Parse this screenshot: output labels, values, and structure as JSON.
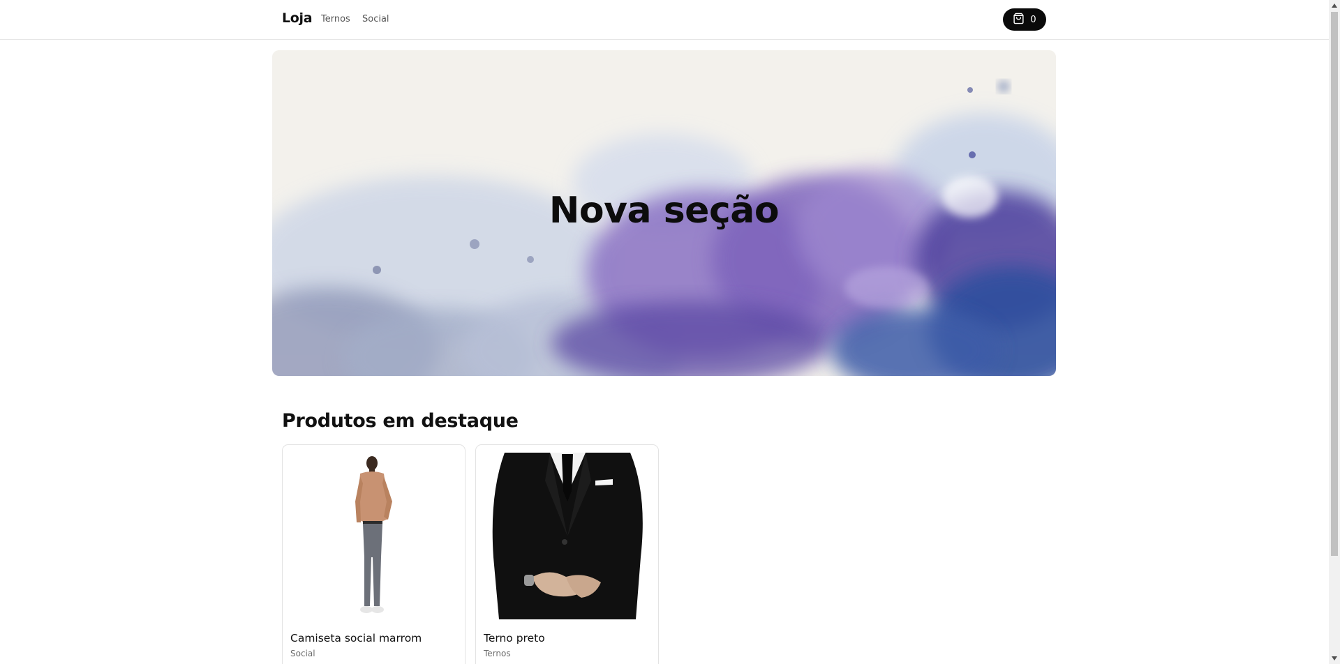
{
  "header": {
    "logo": "Loja",
    "nav": [
      {
        "label": "Ternos"
      },
      {
        "label": "Social"
      }
    ],
    "cart": {
      "icon": "shopping-bag-icon",
      "count": "0"
    }
  },
  "hero": {
    "title": "Nova seção",
    "background": "watercolor-purple-blue"
  },
  "featured": {
    "title": "Produtos em destaque",
    "products": [
      {
        "name": "Camiseta social marrom",
        "category": "Social",
        "image": "man-in-brown-shirt"
      },
      {
        "name": "Terno preto",
        "category": "Ternos",
        "image": "black-suit"
      }
    ]
  },
  "colors": {
    "accent": "#0a0a0a",
    "hero_purple": "#6a4fb3",
    "hero_blue": "#3a5aa8"
  }
}
